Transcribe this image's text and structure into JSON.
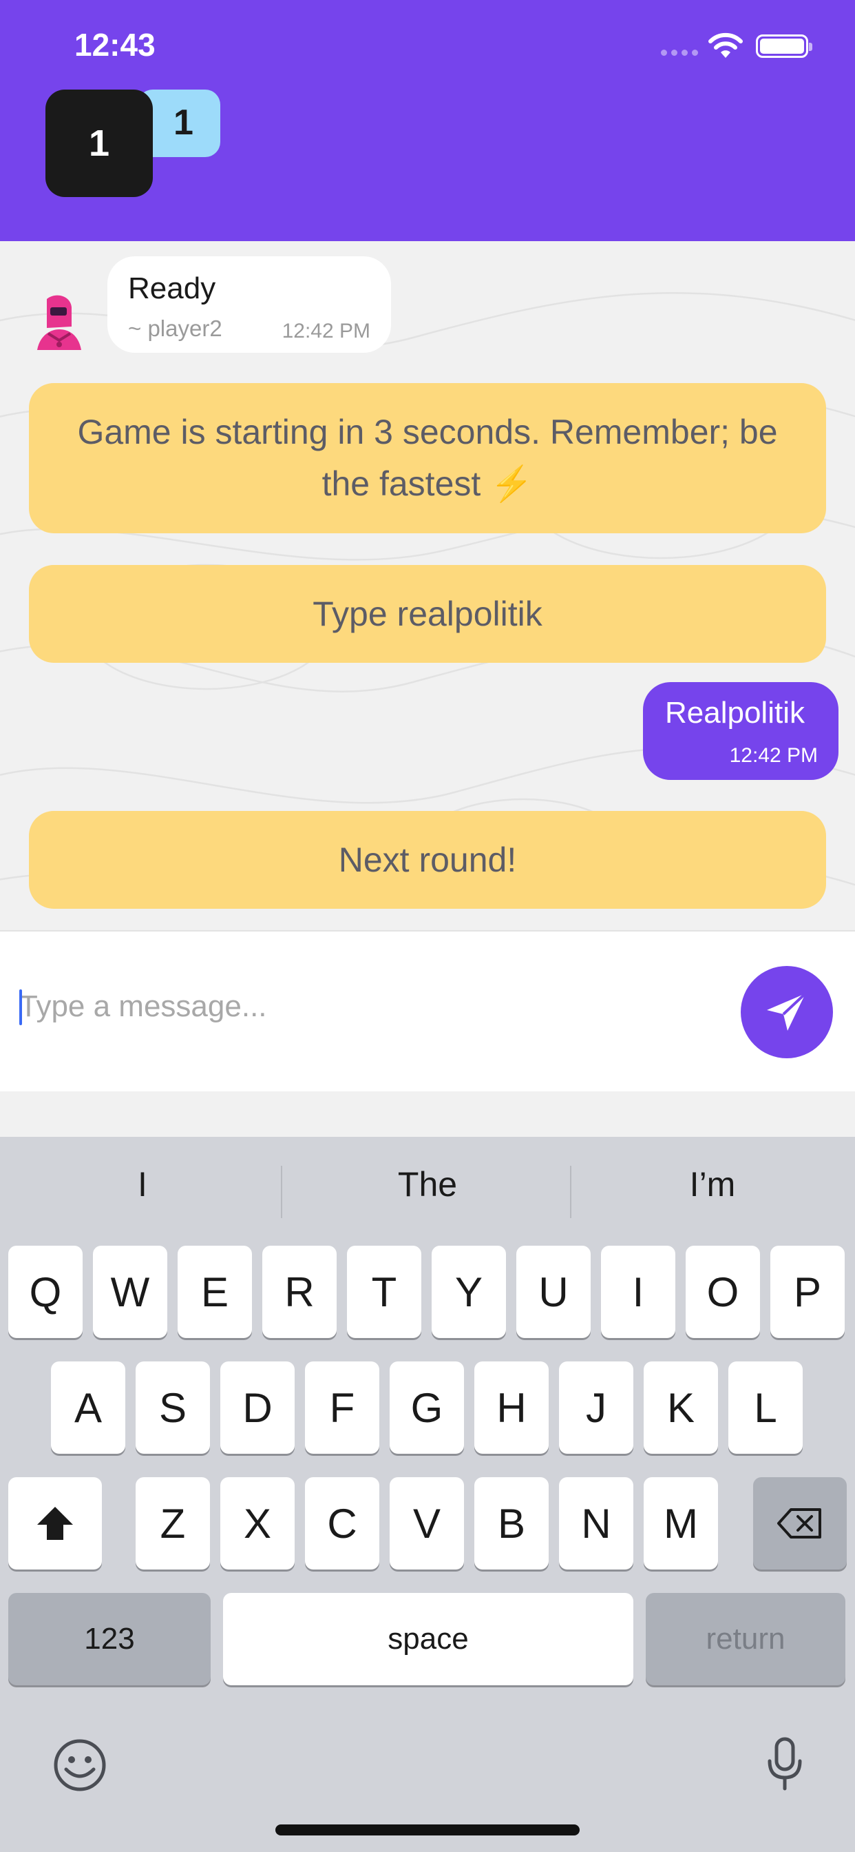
{
  "status_bar": {
    "time": "12:43"
  },
  "scores": {
    "player": "1",
    "opponent": "1"
  },
  "colors": {
    "accent": "#7644ec",
    "system_bubble": "#fdd97d",
    "opponent_score_bg": "#9ddbfa"
  },
  "messages": {
    "incoming": {
      "text": "Ready",
      "sender": "~ player2",
      "time": "12:42 PM"
    },
    "system1": "Game is starting in 3 seconds. Remember; be the fastest ⚡️",
    "system2": "Type realpolitik",
    "outgoing": {
      "text": "Realpolitik",
      "time": "12:42 PM"
    },
    "system3": "Next round!"
  },
  "composer": {
    "placeholder": "Type a message...",
    "value": "",
    "send_icon": "send-icon"
  },
  "keyboard": {
    "suggestions": [
      "I",
      "The",
      "I’m"
    ],
    "row1": [
      "Q",
      "W",
      "E",
      "R",
      "T",
      "Y",
      "U",
      "I",
      "O",
      "P"
    ],
    "row2": [
      "A",
      "S",
      "D",
      "F",
      "G",
      "H",
      "J",
      "K",
      "L"
    ],
    "row3": [
      "Z",
      "X",
      "C",
      "V",
      "B",
      "N",
      "M"
    ],
    "numbers_label": "123",
    "space_label": "space",
    "return_label": "return"
  }
}
